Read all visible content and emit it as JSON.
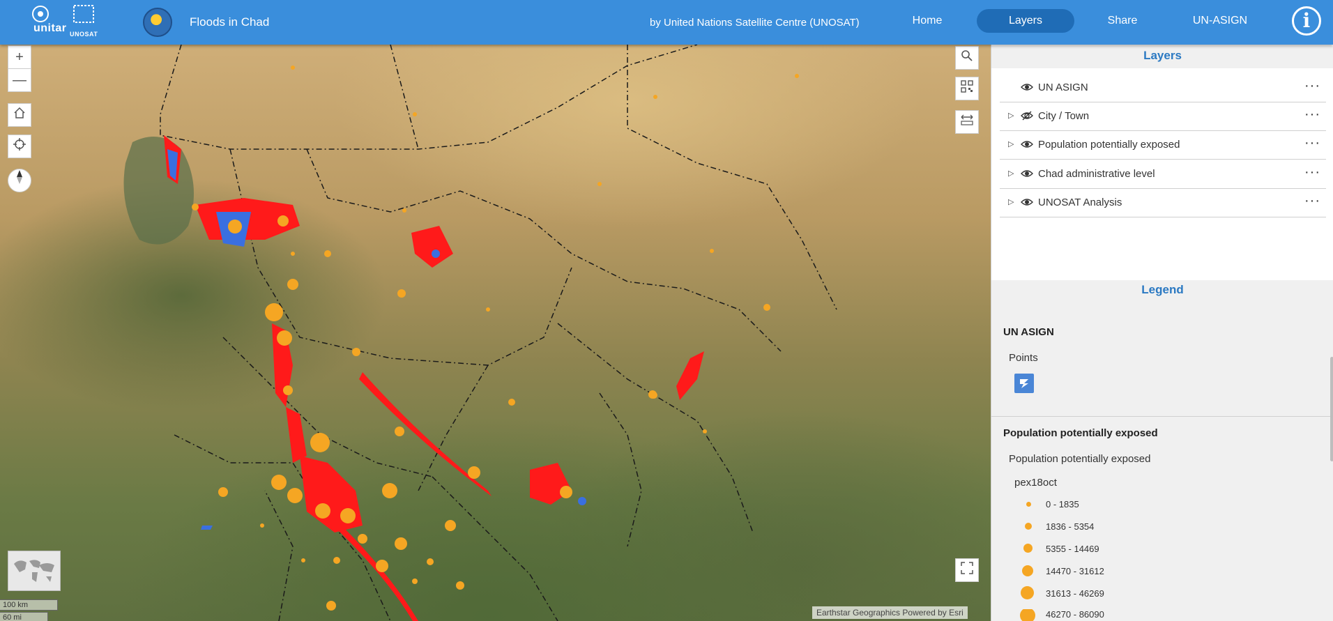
{
  "header": {
    "logo_text": "unitar",
    "logo_sub": "UNOSAT",
    "title": "Floods in Chad",
    "byline": "by United Nations Satellite Centre (UNOSAT)",
    "nav": [
      "Home",
      "Layers",
      "Share",
      "UN-ASIGN"
    ],
    "active_nav": "Layers",
    "info_glyph": "i"
  },
  "map_controls": {
    "zoom_in": "+",
    "zoom_out": "—",
    "home_icon": "home-icon",
    "locate_icon": "crosshair-icon",
    "compass_icon": "compass-icon",
    "search_icon": "search-icon",
    "qr_icon": "qr-code-icon",
    "measure_icon": "measure-icon",
    "fullscreen_icon": "fullscreen-icon"
  },
  "scale": {
    "km": "100 km",
    "mi": "60 mi"
  },
  "attribution": "Earthstar Geographics   Powered by Esri",
  "layers_panel": {
    "title": "Layers",
    "items": [
      {
        "label": "UN ASIGN",
        "expandable": false
      },
      {
        "label": "City / Town",
        "expandable": true,
        "eye": "eye-slash-icon"
      },
      {
        "label": "Population potentially exposed",
        "expandable": true
      },
      {
        "label": "Chad administrative level",
        "expandable": true
      },
      {
        "label": "UNOSAT Analysis",
        "expandable": true
      }
    ],
    "more": "···"
  },
  "legend": {
    "title": "Legend",
    "group1": {
      "title": "UN ASIGN",
      "sublabel": "Points"
    },
    "group2": {
      "title": "Population potentially exposed",
      "sublabel": "Population potentially exposed",
      "field": "pex18oct",
      "classes": [
        "0 - 1835",
        "1836 - 5354",
        "5355 - 14469",
        "14470 - 31612",
        "31613 - 46269",
        "46270 - 86090"
      ]
    }
  },
  "colors": {
    "header_bg": "#3a8edc",
    "active_nav_bg": "#1f6cb6",
    "accent_text": "#2b79c2",
    "flood_red": "#ff1a1a",
    "water_blue": "#3a6fe0",
    "population_dot": "#f5a623"
  }
}
